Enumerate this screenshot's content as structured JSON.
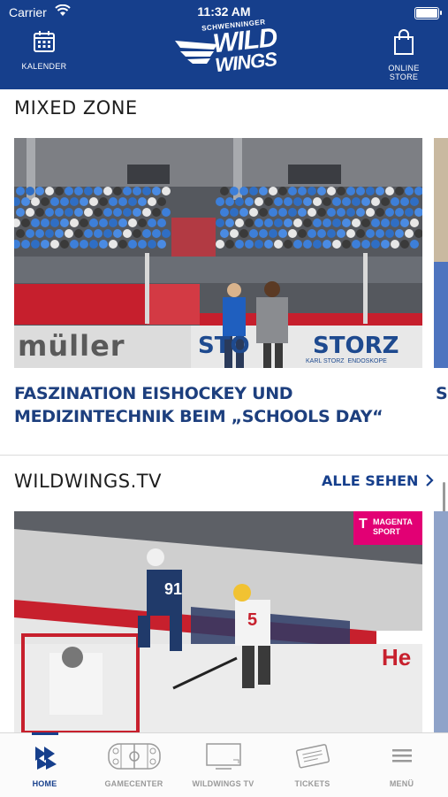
{
  "status": {
    "carrier": "Carrier",
    "time": "11:32 AM"
  },
  "header": {
    "left_label": "KALENDER",
    "right_label": "ONLINE STORE",
    "logo_top": "SCHWENNINGER",
    "logo_line1": "WILD",
    "logo_line2": "WINGS"
  },
  "mixed_zone": {
    "title": "MIXED ZONE",
    "headline": "FASZINATION EISHOCKEY UND MEDIZINTECHNIK BEIM „SCHOOLS DAY“",
    "next_headline": "S",
    "banner_left": "müller",
    "banner_right": "STORZ",
    "banner_right_sub": "KARL STORZ  ENDOSKOPE",
    "banner_center": "STO"
  },
  "wildwings_tv": {
    "title": "WILDWINGS.TV",
    "see_all": "ALLE SEHEN",
    "badge_line1": "MAGENTA",
    "badge_line2": "SPORT",
    "jersey_a": "91",
    "jersey_b": "5",
    "board_text": "He"
  },
  "tabs": [
    {
      "label": "HOME",
      "icon": "home-logo-icon",
      "active": true
    },
    {
      "label": "GAMECENTER",
      "icon": "rink-icon",
      "active": false
    },
    {
      "label": "WILDWINGS TV",
      "icon": "tv-icon",
      "active": false
    },
    {
      "label": "TICKETS",
      "icon": "ticket-icon",
      "active": false
    },
    {
      "label": "MENÜ",
      "icon": "menu-icon",
      "active": false
    }
  ],
  "colors": {
    "brand": "#163f8c",
    "headline": "#1d3f7e",
    "magenta": "#e20074"
  }
}
